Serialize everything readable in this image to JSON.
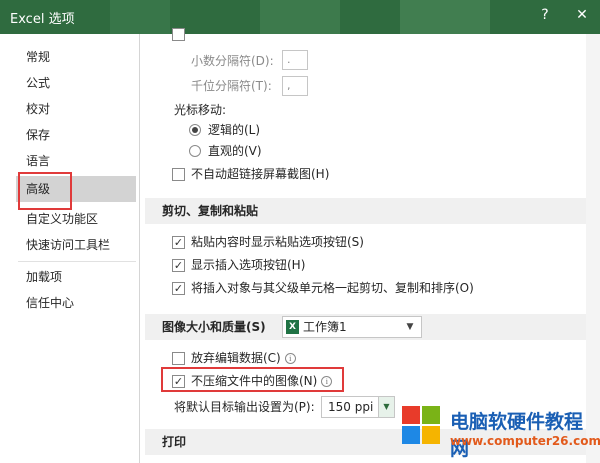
{
  "window": {
    "title": "Excel 选项",
    "help": "?",
    "close": "✕"
  },
  "nav": {
    "items": [
      {
        "label": "常规"
      },
      {
        "label": "公式"
      },
      {
        "label": "校对"
      },
      {
        "label": "保存"
      },
      {
        "label": "语言"
      },
      {
        "label": "高级",
        "selected": true
      },
      {
        "label": "自定义功能区"
      },
      {
        "label": "快速访问工具栏"
      },
      {
        "label": "加载项"
      },
      {
        "label": "信任中心"
      }
    ]
  },
  "edit": {
    "decimal_sep_label": "小数分隔符(D):",
    "decimal_sep_value": ".",
    "thousands_sep_label": "千位分隔符(T):",
    "thousands_sep_value": ",",
    "cursor_move_label": "光标移动:",
    "radio_logical": "逻辑的(L)",
    "radio_logical_checked": true,
    "radio_visual": "直观的(V)",
    "radio_visual_checked": false,
    "no_auto_hyperlink": "不自动超链接屏幕截图(H)",
    "no_auto_hyperlink_checked": false
  },
  "cut_copy_paste": {
    "header": "剪切、复制和粘贴",
    "show_paste_options": "粘贴内容时显示粘贴选项按钮(S)",
    "show_paste_options_checked": true,
    "show_insert_options": "显示插入选项按钮(H)",
    "show_insert_options_checked": true,
    "cut_copy_sort_objects": "将插入对象与其父级单元格一起剪切、复制和排序(O)",
    "cut_copy_sort_objects_checked": true
  },
  "image_size": {
    "header": "图像大小和质量(S)",
    "workbook_select": "工作簿1",
    "discard_edit_data": "放弃编辑数据(C)",
    "discard_edit_data_checked": false,
    "no_compress": "不压缩文件中的图像(N)",
    "no_compress_checked": true,
    "default_output_label": "将默认目标输出设置为(P):",
    "default_output_value": "150 ppi"
  },
  "print": {
    "header": "打印"
  },
  "watermark": {
    "name": "电脑软硬件教程网",
    "url": "www.computer26.com"
  },
  "colors": {
    "accent": "#1f7244",
    "highlight": "#e03a3a",
    "nav_selected": "#d3d3d3"
  }
}
